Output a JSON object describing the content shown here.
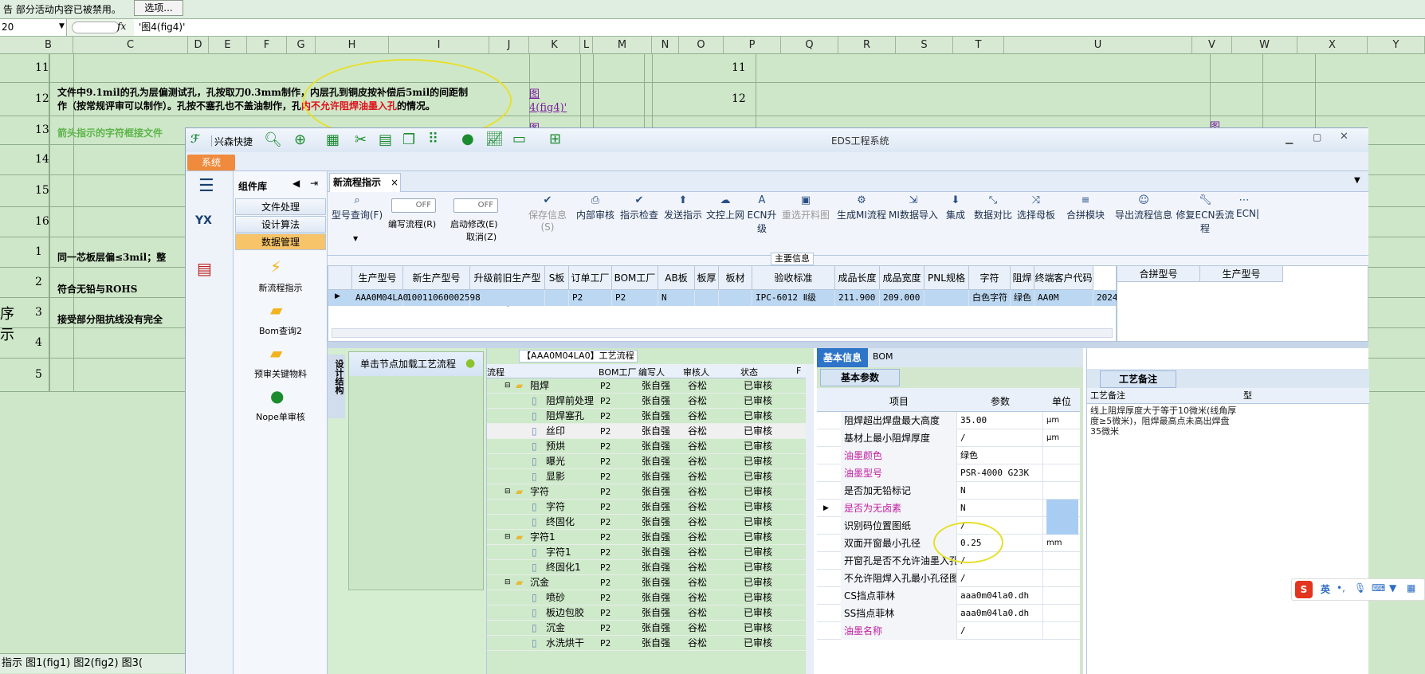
{
  "excel": {
    "info_bar": "告 部分活动内容已被禁用。",
    "options_button": "选项...",
    "name_box": "20",
    "formula": "'图4(fig4)'",
    "fx": "fx",
    "columns": [
      "B",
      "C",
      "D",
      "E",
      "F",
      "G",
      "H",
      "I",
      "J",
      "K",
      "L",
      "M",
      "N",
      "O",
      "P",
      "Q",
      "R",
      "S",
      "T",
      "U",
      "V",
      "W",
      "X",
      "Y"
    ],
    "rows_left": [
      "11",
      "12",
      "13",
      "14",
      "15",
      "16",
      "1",
      "2",
      "3",
      "4",
      "5"
    ],
    "rows_right": [
      "11",
      "12"
    ],
    "cell_row12_text_a": "文件中9.1mil的孔为层偏测试孔，孔按取刀0.3mm制作，内层孔到铜皮按补偿后5mil的间距制",
    "cell_row12_text_b": "作（按常规评审可以制作）。孔按不塞孔也不盖油制作，孔",
    "cell_row12_red": "内不允许阻焊油墨入孔",
    "cell_row12_tail": "的情况。",
    "cell_row13_text": "箭头指示的字符框接文件",
    "cell_row1_text": "同一芯板层偏≤3mil；整",
    "cell_row2_text": "符合无铅与ROHS",
    "cell_row3_text": "接受部分阻抗线没有完全",
    "link_fig4_a": "图",
    "link_fig4_b": "4(fig4)'",
    "link_fig_row13": "图",
    "link_fig_v": "图",
    "left_label_a": "序",
    "left_label_b": "示",
    "sheet_tabs": "指示 图1(fig1) 图2(fig2) 图3("
  },
  "app": {
    "title": "EDS工程系统",
    "quick_label": "兴森快捷",
    "system_tab": "系统",
    "component_lib": "组件库",
    "groups": [
      "文件处理",
      "设计算法",
      "数据管理"
    ],
    "group_items": [
      "新流程指示",
      "Bom查询2",
      "预审关键物料",
      "Nope单审核"
    ],
    "tab_title": "新流程指示",
    "toolbar": {
      "model_query": "型号查询(F)",
      "edit_flow": "编写流程(R)",
      "toggle_off": "OFF",
      "start_edit": "启动修改(E)",
      "cancel": "取消(Z)",
      "buttons": [
        "保存信息(S)",
        "内部审核",
        "指示检查",
        "发送指示",
        "文控上网",
        "ECN升级",
        "重选开料图",
        "生成MI流程",
        "MI数据导入",
        "集成",
        "数据对比",
        "选择母板",
        "合拼模块",
        "导出流程信息",
        "修复ECN丢流程",
        "ECN|"
      ]
    },
    "main_info_title": "主要信息",
    "grid_headers": [
      "生产型号",
      "新生产型号",
      "升级前旧生产型号",
      "S板",
      "订单工厂",
      "BOM工厂",
      "AB板",
      "板厚",
      "板材",
      "验收标准",
      "成品长度",
      "成品宽度",
      "PNL规格",
      "字符",
      "阻焊",
      "终端客户代码"
    ],
    "grid_row": [
      "AAA0M04LA0",
      "10011060002598",
      "",
      "",
      "P2",
      "P2",
      "N",
      "",
      "",
      "IPC-6012 Ⅱ级",
      "211.900",
      "209.000",
      "",
      "白色字符",
      "绿色",
      "AA0M",
      "2024"
    ],
    "merge_headers": [
      "合拼型号",
      "生产型号"
    ],
    "flow_title": "【AAA0M04LA0】工艺流程",
    "vertical_tab": "设计结构",
    "node_hint": "单击节点加载工艺流程",
    "flow_headers": [
      "流程",
      "BOM工厂",
      "编写人",
      "审核人",
      "状态",
      "F"
    ],
    "flow_rows": [
      {
        "name": "阻焊",
        "lvl": 0,
        "bom": "P2",
        "w": "张自强",
        "r": "谷松",
        "s": "已审核"
      },
      {
        "name": "阻焊前处理",
        "lvl": 1,
        "bom": "P2",
        "w": "张自强",
        "r": "谷松",
        "s": "已审核"
      },
      {
        "name": "阻焊塞孔",
        "lvl": 1,
        "bom": "P2",
        "w": "张自强",
        "r": "谷松",
        "s": "已审核"
      },
      {
        "name": "丝印",
        "lvl": 1,
        "bom": "P2",
        "w": "张自强",
        "r": "谷松",
        "s": "已审核"
      },
      {
        "name": "预烘",
        "lvl": 1,
        "bom": "P2",
        "w": "张自强",
        "r": "谷松",
        "s": "已审核"
      },
      {
        "name": "曝光",
        "lvl": 1,
        "bom": "P2",
        "w": "张自强",
        "r": "谷松",
        "s": "已审核"
      },
      {
        "name": "显影",
        "lvl": 1,
        "bom": "P2",
        "w": "张自强",
        "r": "谷松",
        "s": "已审核"
      },
      {
        "name": "字符",
        "lvl": 0,
        "bom": "P2",
        "w": "张自强",
        "r": "谷松",
        "s": "已审核"
      },
      {
        "name": "字符",
        "lvl": 1,
        "bom": "P2",
        "w": "张自强",
        "r": "谷松",
        "s": "已审核"
      },
      {
        "name": "终固化",
        "lvl": 1,
        "bom": "P2",
        "w": "张自强",
        "r": "谷松",
        "s": "已审核"
      },
      {
        "name": "字符1",
        "lvl": 0,
        "bom": "P2",
        "w": "张自强",
        "r": "谷松",
        "s": "已审核"
      },
      {
        "name": "字符1",
        "lvl": 1,
        "bom": "P2",
        "w": "张自强",
        "r": "谷松",
        "s": "已审核"
      },
      {
        "name": "终固化1",
        "lvl": 1,
        "bom": "P2",
        "w": "张自强",
        "r": "谷松",
        "s": "已审核"
      },
      {
        "name": "沉金",
        "lvl": 0,
        "bom": "P2",
        "w": "张自强",
        "r": "谷松",
        "s": "已审核"
      },
      {
        "name": "喷砂",
        "lvl": 1,
        "bom": "P2",
        "w": "张自强",
        "r": "谷松",
        "s": "已审核"
      },
      {
        "name": "板边包胶",
        "lvl": 1,
        "bom": "P2",
        "w": "张自强",
        "r": "谷松",
        "s": "已审核"
      },
      {
        "name": "沉金",
        "lvl": 1,
        "bom": "P2",
        "w": "张自强",
        "r": "谷松",
        "s": "已审核"
      },
      {
        "name": "水洗烘干",
        "lvl": 1,
        "bom": "P2",
        "w": "张自强",
        "r": "谷松",
        "s": "已审核"
      }
    ],
    "info_tabs": [
      "基本信息",
      "BOM"
    ],
    "basic_params": "基本参数",
    "param_headers": [
      "项目",
      "参数",
      "单位"
    ],
    "params": [
      {
        "k": "阻焊超出焊盘最大高度",
        "v": "35.00",
        "u": "μm",
        "pink": false
      },
      {
        "k": "基材上最小阻焊厚度",
        "v": "/",
        "u": "μm",
        "pink": false
      },
      {
        "k": "油墨颜色",
        "v": "绿色",
        "u": "",
        "pink": true
      },
      {
        "k": "油墨型号",
        "v": "PSR-4000 G23K",
        "u": "",
        "pink": true
      },
      {
        "k": "是否加无铅标记",
        "v": "N",
        "u": "",
        "pink": false
      },
      {
        "k": "是否为无卤素",
        "v": "N",
        "u": "",
        "pink": true
      },
      {
        "k": "识别码位置图纸",
        "v": "/",
        "u": "",
        "pink": false
      },
      {
        "k": "双面开窗最小孔径",
        "v": "0.25",
        "u": "mm",
        "pink": false
      },
      {
        "k": "开窗孔是否不允许油墨入孔",
        "v": "/",
        "u": "",
        "pink": false
      },
      {
        "k": "不允许阻焊入孔最小孔径图纸",
        "v": "/",
        "u": "",
        "pink": false
      },
      {
        "k": "CS挡点菲林",
        "v": "aaa0m04la0.dh",
        "u": "",
        "pink": false
      },
      {
        "k": "SS挡点菲林",
        "v": "aaa0m04la0.dh",
        "u": "",
        "pink": false
      },
      {
        "k": "油墨名称",
        "v": "/",
        "u": "",
        "pink": true
      }
    ],
    "remark_title": "工艺备注",
    "remark_header": "工艺备注",
    "remark_col2": "型",
    "remark_text": "线上阻焊厚度大于等于10微米(线角厚度≥5微米)，阻焊最高点未高出焊盘35微米"
  },
  "ime": {
    "label": "英"
  }
}
